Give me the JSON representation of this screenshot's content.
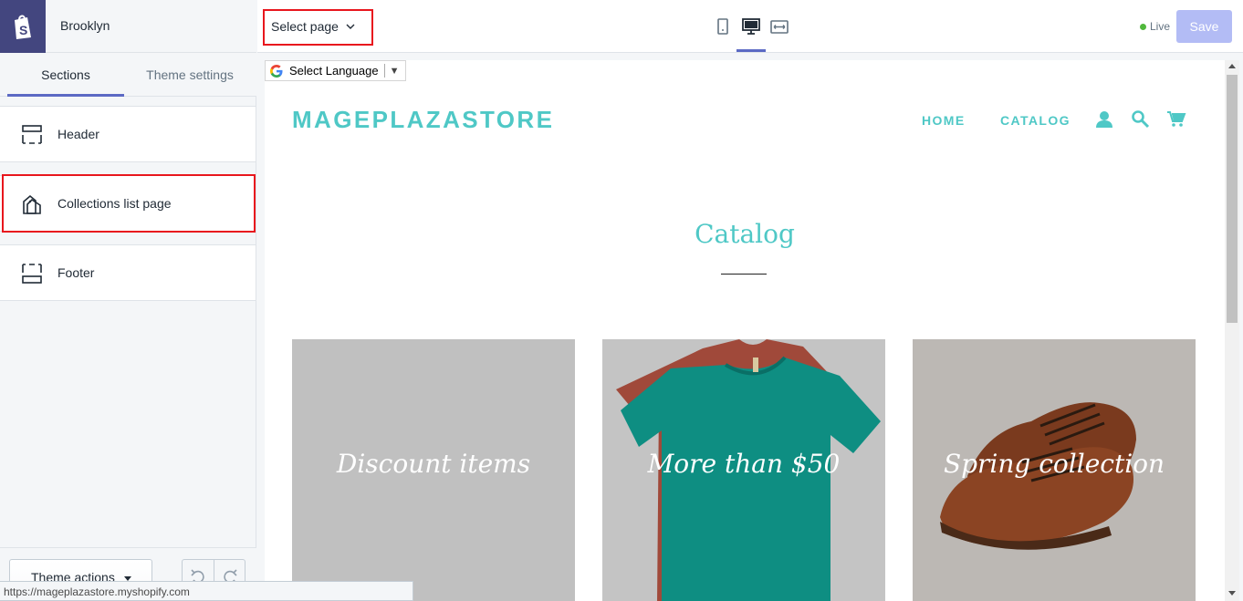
{
  "sidebar": {
    "store_name": "Brooklyn",
    "tabs": [
      {
        "label": "Sections",
        "active": true
      },
      {
        "label": "Theme settings",
        "active": false
      }
    ],
    "sections": [
      {
        "label": "Header",
        "icon": "header-layout-icon"
      },
      {
        "label": "Collections list page",
        "icon": "collections-icon"
      },
      {
        "label": "Footer",
        "icon": "footer-layout-icon"
      }
    ],
    "theme_actions_label": "Theme actions"
  },
  "topbar": {
    "select_page_label": "Select page",
    "viewports": [
      "mobile-icon",
      "desktop-icon",
      "fullscreen-icon"
    ],
    "active_viewport": "desktop",
    "status_label": "Live",
    "save_label": "Save"
  },
  "preview": {
    "language_widget": "Select Language",
    "store_logo": "MAGEPLAZASTORE",
    "nav": [
      "HOME",
      "CATALOG"
    ],
    "nav_icons": [
      "account-icon",
      "search-icon",
      "cart-icon"
    ],
    "page_title": "Catalog",
    "collections": [
      {
        "label": "Discount items"
      },
      {
        "label": "More than $50"
      },
      {
        "label": "Spring collection"
      }
    ]
  },
  "status_bar_url": "https://mageplazastore.myshopify.com",
  "colors": {
    "accent": "#5c6ac4",
    "brand_dark": "#43467f",
    "store_teal": "#4fc8c6",
    "highlight_red": "#e8161d",
    "save_disabled": "#b3bcf5"
  }
}
